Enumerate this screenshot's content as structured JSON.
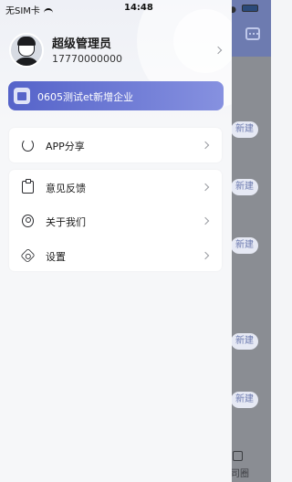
{
  "status_bar": {
    "carrier": "无SIM卡",
    "time": "14:48"
  },
  "user": {
    "name": "超级管理员",
    "phone": "17770000000"
  },
  "company": {
    "label": "0605测试et新增企业"
  },
  "menu": {
    "share": "APP分享",
    "feedback": "意见反馈",
    "about": "关于我们",
    "settings": "设置"
  },
  "background": {
    "new_label": "新建",
    "bottom_tab_label": "司圈"
  },
  "colors": {
    "accent": "#5563c9",
    "drawer_bg": "#f6f7f9",
    "overlay": "#8a8d93"
  }
}
